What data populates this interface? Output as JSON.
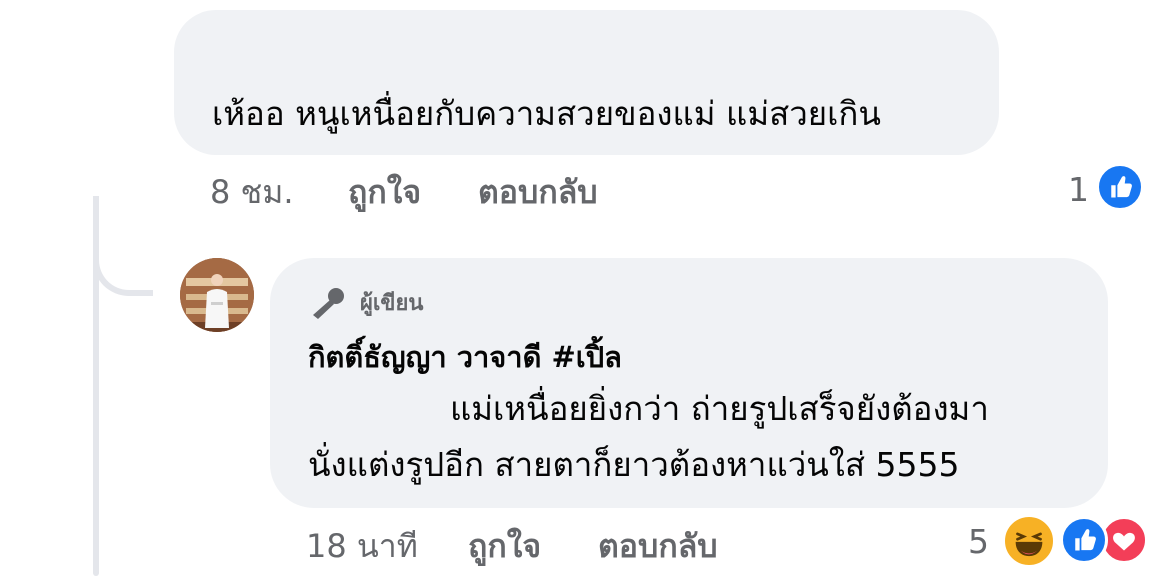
{
  "comment": {
    "text": "เห้ออ หนูเหนื่อยกับความสวยของแม่ แม่สวยเกิน",
    "time": "8 ชม.",
    "like_action": "ถูกใจ",
    "reply_action": "ตอบกลับ",
    "reaction_count": "1",
    "reactions": [
      "like-icon"
    ]
  },
  "reply": {
    "badge": "ผู้เขียน",
    "author": "กิตติ์ธัญญา วาจาดี #เปิ้ล",
    "text_line_1": "แม่เหนื่อยยิ่งกว่า  ถ่ายรูปเสร็จยังต้องมา",
    "text_line_2": "นั่งแต่งรูปอีก สายตาก็ยาวต้องหาแว่นใส่ 5555",
    "time": "18 นาที",
    "like_action": "ถูกใจ",
    "reply_action": "ตอบกลับ",
    "reaction_count": "5",
    "reactions": [
      "haha-icon",
      "like-icon",
      "love-icon"
    ]
  },
  "colors": {
    "bubble_bg": "#f0f2f5",
    "meta_text": "#65676b",
    "like_blue": "#1877f2",
    "love_red": "#f33e58",
    "haha_yellow": "#f7b125"
  }
}
